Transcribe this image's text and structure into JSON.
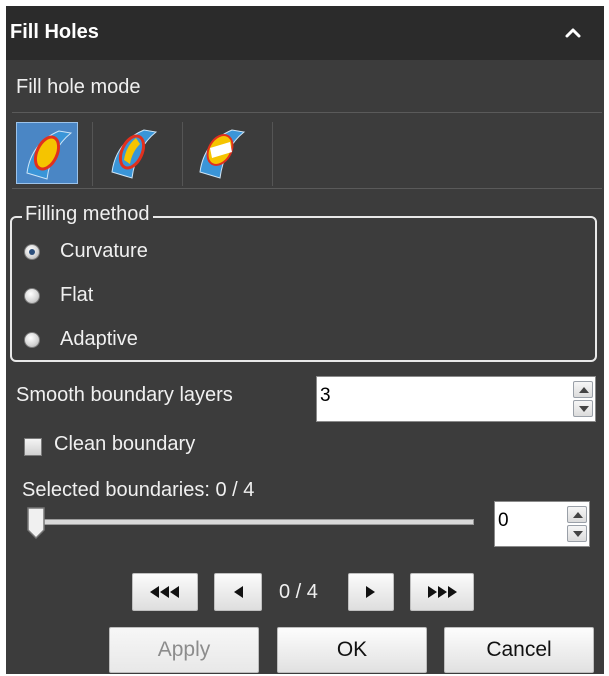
{
  "header": {
    "title": "Fill Holes"
  },
  "mode_section": {
    "label": "Fill hole mode",
    "selected_index": 0
  },
  "filling_method": {
    "legend": "Filling method",
    "options": [
      {
        "label": "Curvature",
        "checked": true
      },
      {
        "label": "Flat",
        "checked": false
      },
      {
        "label": "Adaptive",
        "checked": false
      }
    ]
  },
  "smooth_boundary": {
    "label": "Smooth boundary layers",
    "value": "3"
  },
  "clean_boundary": {
    "label": "Clean boundary",
    "checked": false
  },
  "selected_boundaries": {
    "label": "Selected boundaries: 0 / 4",
    "slider_fraction": 0,
    "spin_value": "0"
  },
  "navigation": {
    "counter": "0 / 4"
  },
  "actions": {
    "apply": "Apply",
    "ok": "OK",
    "cancel": "Cancel"
  },
  "colors": {
    "panel": "#3c3c3c",
    "header": "#2b2b2b",
    "mode_active": "#4a86c5",
    "hole_fill": "#f5c400",
    "hole_outline": "#e0301e"
  },
  "icons": [
    "chevron-up-icon",
    "fill-hole-full-icon",
    "fill-hole-partial-icon",
    "fill-hole-bridge-icon",
    "first-icon",
    "previous-icon",
    "next-icon",
    "last-icon"
  ]
}
